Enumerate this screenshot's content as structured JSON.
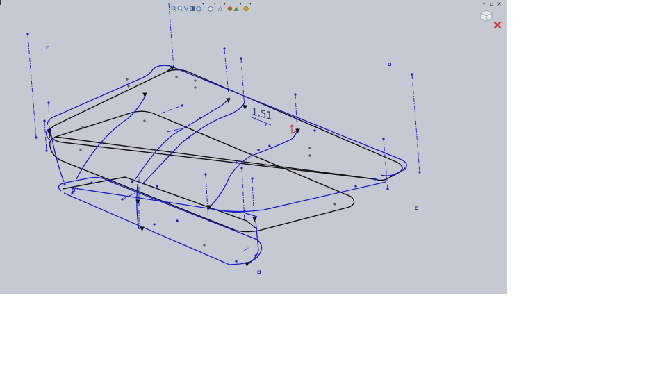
{
  "toolbar": {
    "items": [
      {
        "name": "zoom-to-fit-icon",
        "color": "#4a6fa8"
      },
      {
        "name": "zoom-to-area-icon",
        "color": "#4a6fa8"
      },
      {
        "name": "previous-view-icon",
        "color": "#5c7fb8"
      },
      {
        "name": "section-view-icon",
        "color": "#6b8fc4"
      },
      {
        "name": "view-orientation-icon",
        "color": "#6a87b0"
      },
      {
        "name": "display-style-icon",
        "color": "#5073a6"
      },
      {
        "name": "hide-show-items-icon",
        "color": "#7c7c7c"
      },
      {
        "name": "edit-appearance-icon",
        "color": "#3f9a3f"
      },
      {
        "name": "apply-scene-icon",
        "color": "#4d8f4d"
      },
      {
        "name": "view-settings-icon",
        "color": "#d4a017"
      }
    ],
    "dropdown_glyph": "▾"
  },
  "window": {
    "minimize": "–",
    "restore": "▫",
    "close": "×"
  },
  "dimension": {
    "value": "1.51"
  },
  "colors": {
    "viewport_bg": "#c5c9d2",
    "sketch_blue": "#1a1acf",
    "edge_black": "#111111",
    "dim_blue": "#1e2f6a",
    "origin_red": "#dd2222",
    "close_red": "#cc3b3b"
  }
}
